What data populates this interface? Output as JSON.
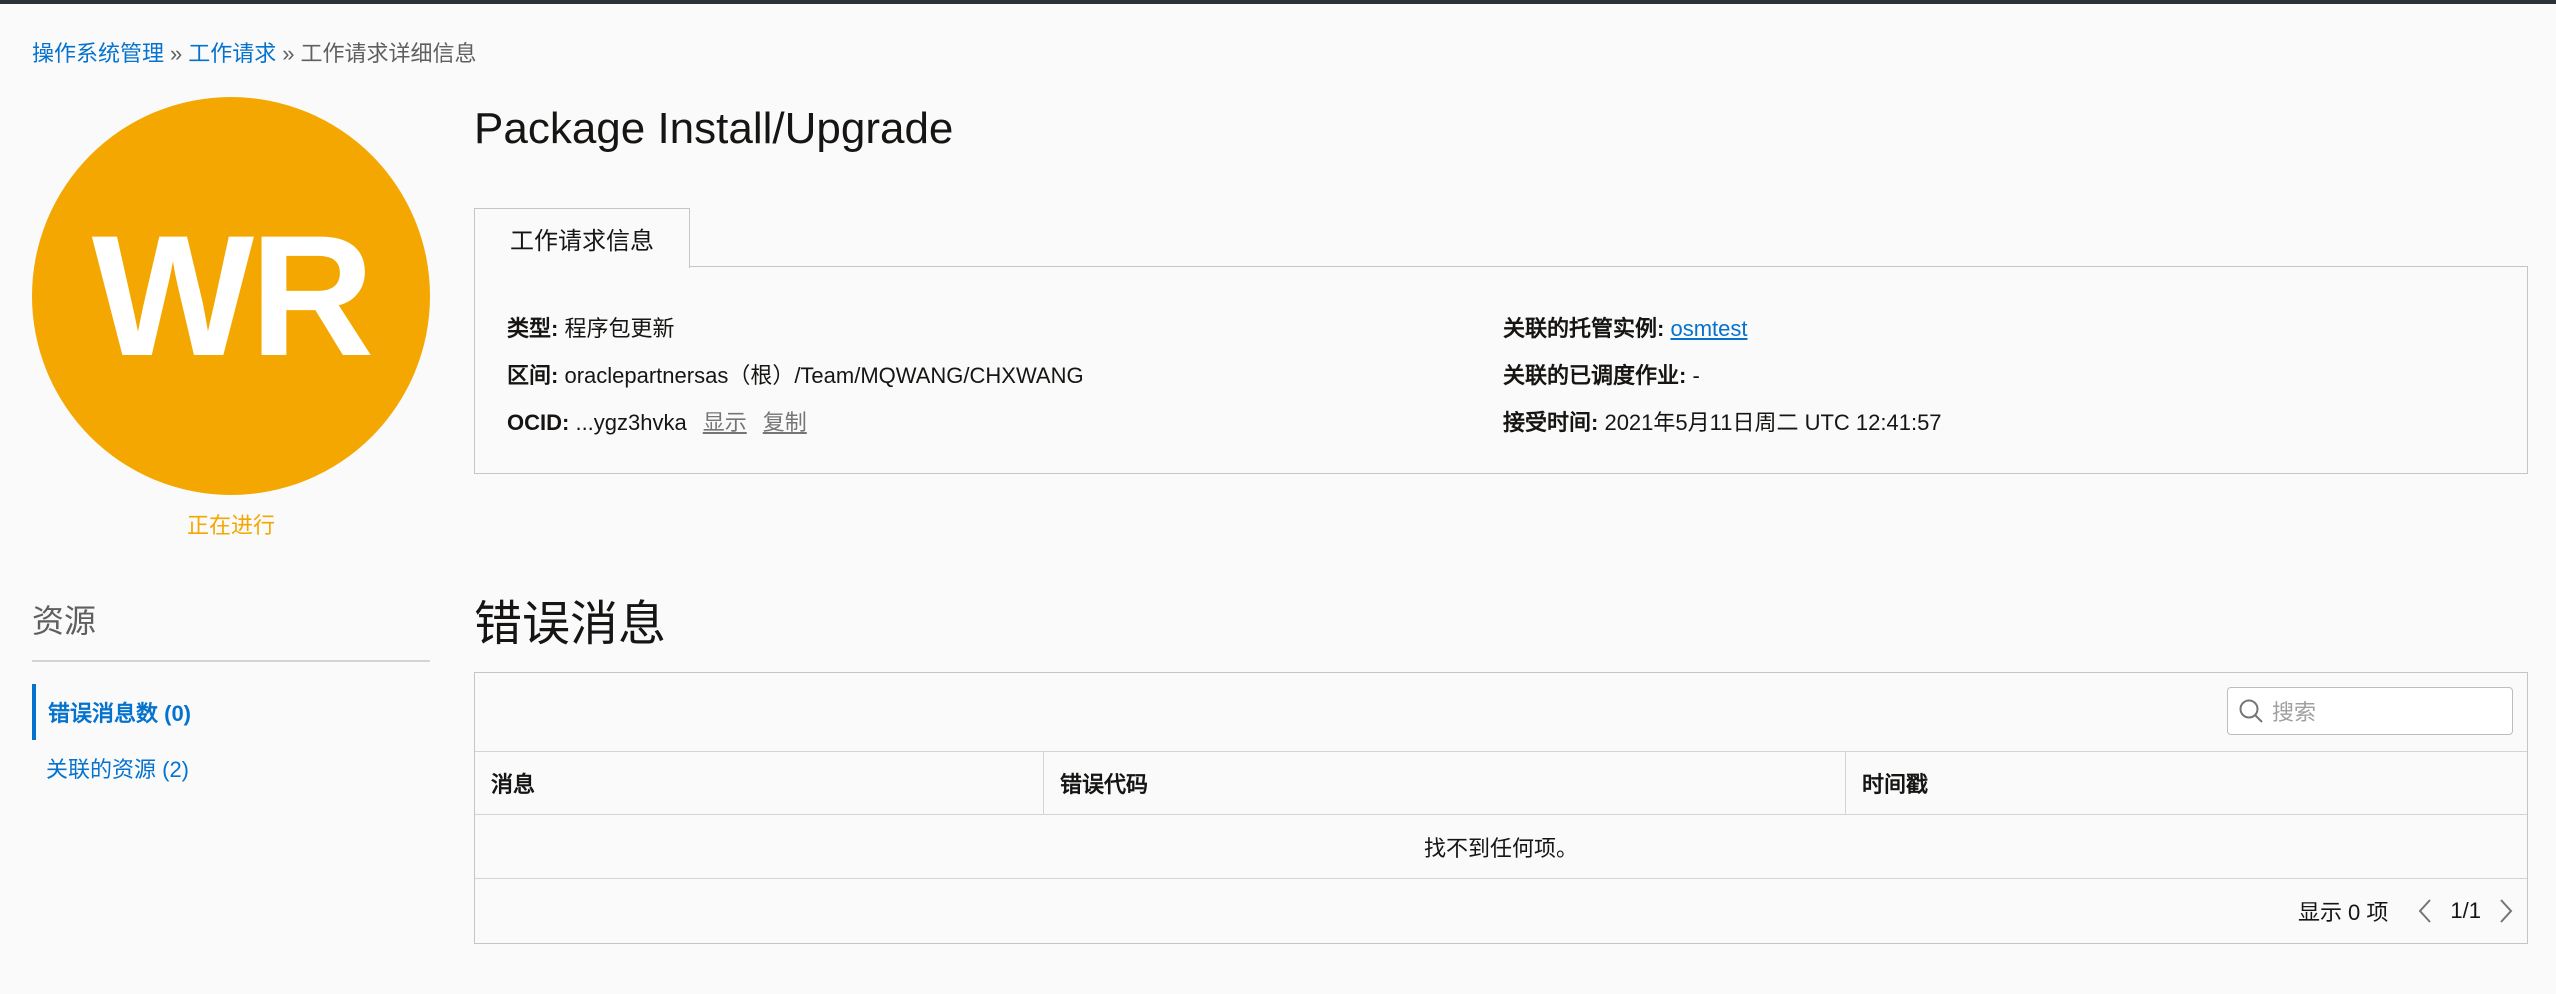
{
  "breadcrumb": {
    "items": [
      "操作系统管理",
      "工作请求"
    ],
    "separator": "»",
    "current": "工作请求详细信息"
  },
  "avatar": {
    "initials": "WR",
    "color": "#f4a700"
  },
  "status": "正在进行",
  "resources": {
    "title": "资源",
    "items": [
      {
        "label": "错误消息数 (0)",
        "active": true
      },
      {
        "label": "关联的资源 (2)",
        "active": false
      }
    ]
  },
  "page_title": "Package Install/Upgrade",
  "info_tab": "工作请求信息",
  "info": {
    "type_label": "类型:",
    "type_value": "程序包更新",
    "compartment_label": "区间:",
    "compartment_value": "oraclepartnersas（根）/Team/MQWANG/CHXWANG",
    "ocid_label": "OCID:",
    "ocid_value": "...ygz3hvka",
    "show_link": "显示",
    "copy_link": "复制",
    "instance_label": "关联的托管实例:",
    "instance_value": "osmtest",
    "job_label": "关联的已调度作业:",
    "job_value": "-",
    "accepted_label": "接受时间:",
    "accepted_value": "2021年5月11日周二 UTC 12:41:57"
  },
  "errors": {
    "title": "错误消息",
    "search_placeholder": "搜索",
    "columns": [
      "消息",
      "错误代码",
      "时间戳"
    ],
    "empty_text": "找不到任何项。",
    "showing": "显示 0 项",
    "page": "1/1"
  },
  "icons": [
    "search-icon",
    "chevron-left-icon",
    "chevron-right-icon"
  ],
  "colors": {
    "link": "#0572ce",
    "accent": "#f4a700"
  }
}
